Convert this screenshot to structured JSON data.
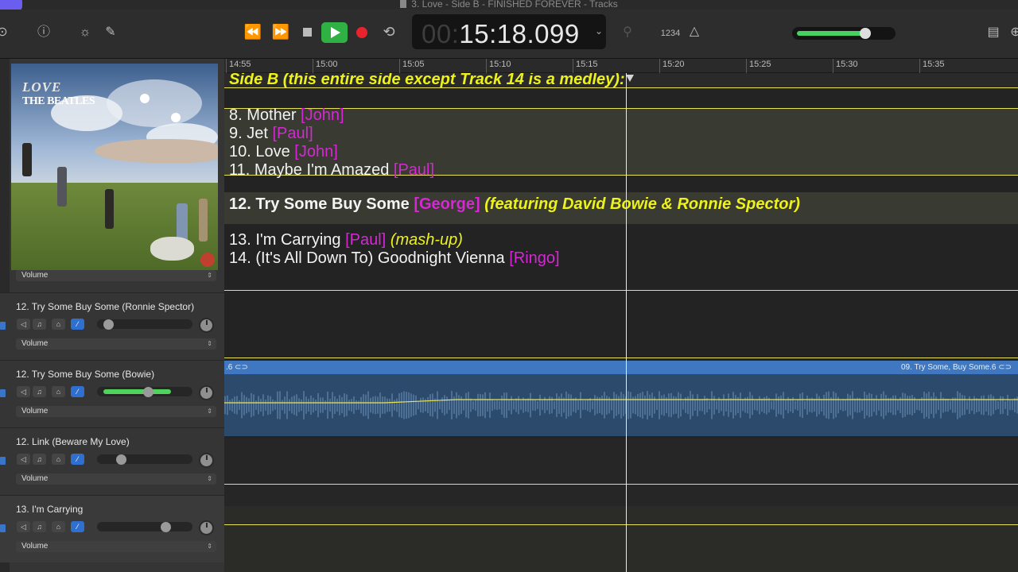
{
  "window": {
    "title": "3. Love - Side B - FINISHED FOREVER - Tracks"
  },
  "toolbar": {
    "rewind_icon": "rewind-icon",
    "forward_icon": "fast-forward-icon",
    "cycle_icon": "cycle-icon",
    "lcd_dim": "00:",
    "lcd_time": "15:18.099",
    "count_in": "1234",
    "metronome_icon": "metronome-icon",
    "master_volume_level": 0.78
  },
  "ruler": {
    "ticks": [
      "14:55",
      "15:00",
      "15:05",
      "15:10",
      "15:15",
      "15:20",
      "15:25",
      "15:30",
      "15:35"
    ]
  },
  "album": {
    "line1": "LOVE",
    "line2": "THE BEATLES"
  },
  "top_track": {
    "automation_param": "Volume"
  },
  "tracks": [
    {
      "name": "12. Try Some Buy Some (Ronnie Spector)",
      "automation_param": "Volume",
      "volume_level": 0.08,
      "meter_level": 0
    },
    {
      "name": "12. Try Some Buy Some (Bowie)",
      "automation_param": "Volume",
      "volume_level": 0.55,
      "meter_level": 0.82
    },
    {
      "name": "12. Link (Beware My Love)",
      "automation_param": "Volume",
      "volume_level": 0.23,
      "meter_level": 0
    },
    {
      "name": "13. I'm Carrying",
      "automation_param": "Volume",
      "volume_level": 0.75,
      "meter_level": 0
    }
  ],
  "notes": {
    "heading": "Side B (this entire side except Track 14 is a medley):",
    "lines": [
      {
        "num": "8. Mother",
        "who": "[John]"
      },
      {
        "num": "9. Jet",
        "who": "[Paul]"
      },
      {
        "num": "10. Love",
        "who": "[John]"
      },
      {
        "num": "11. Maybe I'm Amazed",
        "who": "[Paul]"
      }
    ],
    "line12_title": "12. Try Some Buy Some",
    "line12_who": "[George]",
    "line12_extra": "(featuring David Bowie & Ronnie Spector)",
    "line13_title": "13. I'm Carrying",
    "line13_who": "[Paul]",
    "line13_extra": "(mash-up)",
    "line14_title": "14. (It's All Down To) Goodnight Vienna",
    "line14_who": "[Ringo]"
  },
  "region": {
    "left_label": ".6",
    "right_label": "09. Try Some, Buy Some.6"
  },
  "colors": {
    "automation": "#e7e25a",
    "highlight_text": "#eef21b",
    "credit_text": "#d528d4",
    "region": "#3f78c0",
    "play": "#2fb143",
    "record": "#e8232c"
  }
}
